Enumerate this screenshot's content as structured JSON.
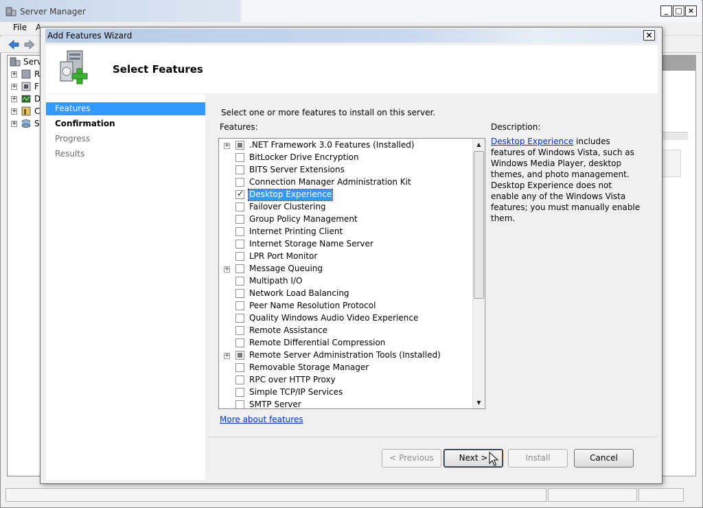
{
  "background_window": {
    "title": "Server Manager",
    "caption_buttons": [
      "_",
      "□",
      "×"
    ],
    "menu": [
      "File",
      "A"
    ],
    "tree": [
      {
        "label": "Serve",
        "icon": "server-manager-icon",
        "expandable": false
      },
      {
        "label": "R",
        "icon": "roles-icon",
        "expandable": true
      },
      {
        "label": "F",
        "icon": "features-icon",
        "expandable": true
      },
      {
        "label": "D",
        "icon": "diagnostics-icon",
        "expandable": true
      },
      {
        "label": "C",
        "icon": "configuration-icon",
        "expandable": true
      },
      {
        "label": "S",
        "icon": "storage-icon",
        "expandable": true
      }
    ]
  },
  "wizard": {
    "title": "Add Features Wizard",
    "close_glyph": "×",
    "heading": "Select Features",
    "nav": [
      {
        "label": "Features",
        "state": "current"
      },
      {
        "label": "Confirmation",
        "state": "next"
      },
      {
        "label": "Progress",
        "state": "disabled"
      },
      {
        "label": "Results",
        "state": "disabled"
      }
    ],
    "instruction": "Select one or more features to install on this server.",
    "features_label": "Features:",
    "features": [
      {
        "label": ".NET Framework 3.0 Features  (Installed)",
        "expandable": true,
        "state": "partial"
      },
      {
        "label": "BitLocker Drive Encryption",
        "expandable": false,
        "state": "unchecked"
      },
      {
        "label": "BITS Server Extensions",
        "expandable": false,
        "state": "unchecked"
      },
      {
        "label": "Connection Manager Administration Kit",
        "expandable": false,
        "state": "unchecked"
      },
      {
        "label": "Desktop Experience",
        "expandable": false,
        "state": "checked",
        "selected": true
      },
      {
        "label": "Failover Clustering",
        "expandable": false,
        "state": "unchecked"
      },
      {
        "label": "Group Policy Management",
        "expandable": false,
        "state": "unchecked"
      },
      {
        "label": "Internet Printing Client",
        "expandable": false,
        "state": "unchecked"
      },
      {
        "label": "Internet Storage Name Server",
        "expandable": false,
        "state": "unchecked"
      },
      {
        "label": "LPR Port Monitor",
        "expandable": false,
        "state": "unchecked"
      },
      {
        "label": "Message Queuing",
        "expandable": true,
        "state": "unchecked"
      },
      {
        "label": "Multipath I/O",
        "expandable": false,
        "state": "unchecked"
      },
      {
        "label": "Network Load Balancing",
        "expandable": false,
        "state": "unchecked"
      },
      {
        "label": "Peer Name Resolution Protocol",
        "expandable": false,
        "state": "unchecked"
      },
      {
        "label": "Quality Windows Audio Video Experience",
        "expandable": false,
        "state": "unchecked"
      },
      {
        "label": "Remote Assistance",
        "expandable": false,
        "state": "unchecked"
      },
      {
        "label": "Remote Differential Compression",
        "expandable": false,
        "state": "unchecked"
      },
      {
        "label": "Remote Server Administration Tools  (Installed)",
        "expandable": true,
        "state": "partial"
      },
      {
        "label": "Removable Storage Manager",
        "expandable": false,
        "state": "unchecked"
      },
      {
        "label": "RPC over HTTP Proxy",
        "expandable": false,
        "state": "unchecked"
      },
      {
        "label": "Simple TCP/IP Services",
        "expandable": false,
        "state": "unchecked"
      },
      {
        "label": "SMTP Server",
        "expandable": false,
        "state": "unchecked"
      }
    ],
    "scroll": {
      "up_glyph": "▲",
      "down_glyph": "▼"
    },
    "more_link": "More about features",
    "description_label": "Description:",
    "description_link": "Desktop Experience",
    "description_text": " includes features of Windows Vista, such as Windows Media Player, desktop themes, and photo management. Desktop Experience does not enable any of the Windows Vista features; you must manually enable them.",
    "buttons": {
      "previous": "< Previous",
      "next": "Next >",
      "install": "Install",
      "cancel": "Cancel"
    }
  },
  "colors": {
    "selection": "#3399ff",
    "link": "#0033cc",
    "disabled_text": "#6d6d6d"
  }
}
